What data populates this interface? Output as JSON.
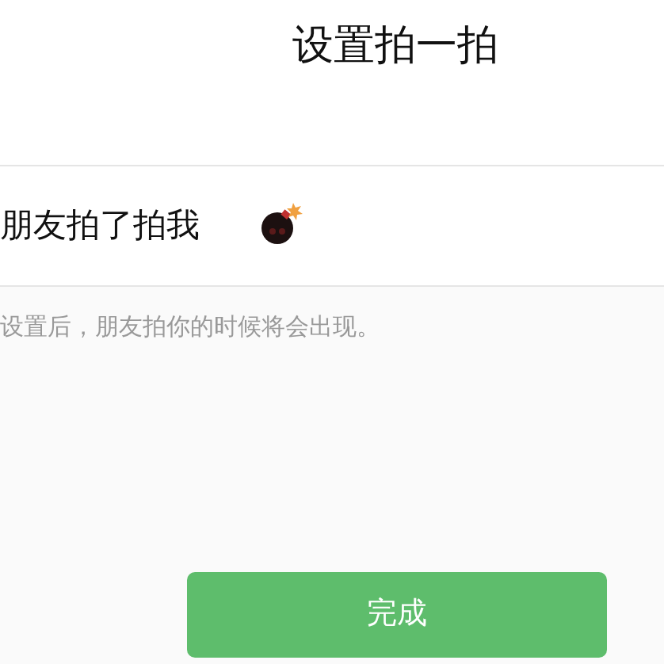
{
  "title": "设置拍一拍",
  "field": {
    "prefix": "朋友拍了拍我"
  },
  "hint": "设置后，朋友拍你的时候将会出现。",
  "button": {
    "label": "完成"
  }
}
